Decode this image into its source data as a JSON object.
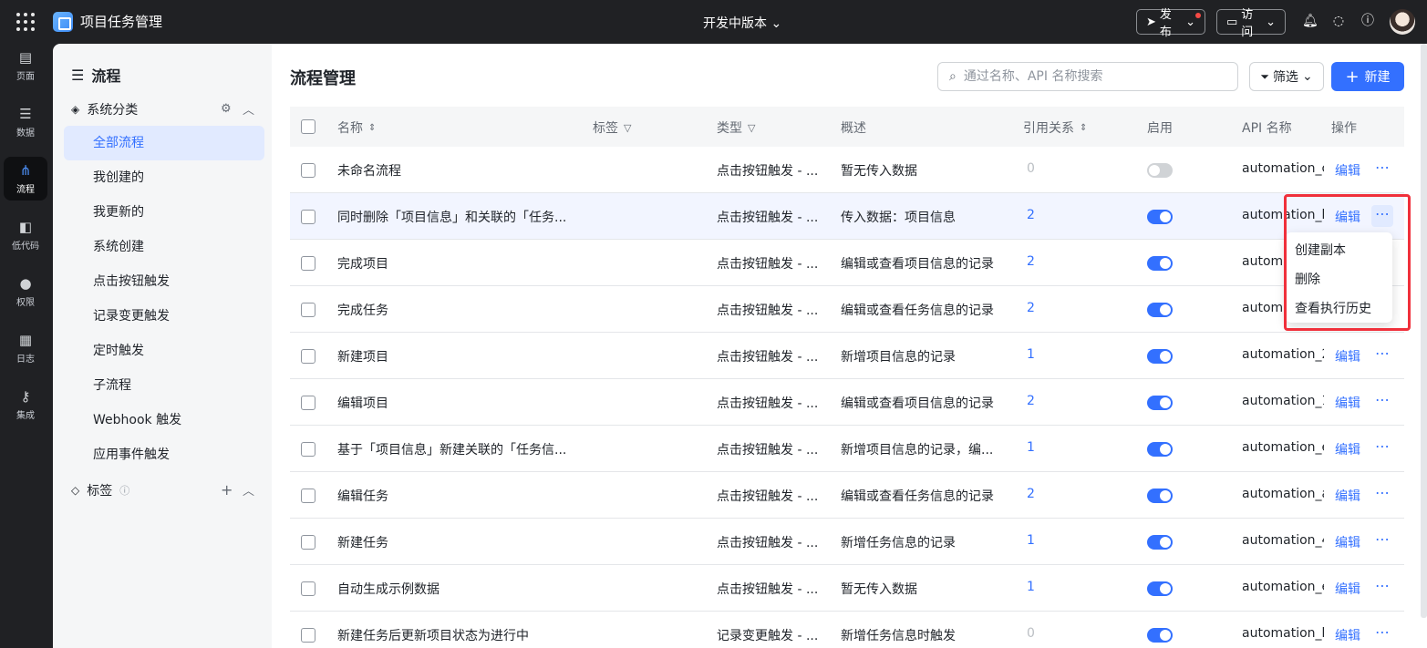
{
  "topbar": {
    "app_title": "项目任务管理",
    "version_label": "开发中版本",
    "publish_label": "发布",
    "visit_label": "访问"
  },
  "leftnav": {
    "items": [
      {
        "label": "页面",
        "icon": "page-icon"
      },
      {
        "label": "数据",
        "icon": "database-icon"
      },
      {
        "label": "流程",
        "icon": "flow-icon",
        "active": true
      },
      {
        "label": "低代码",
        "icon": "code-icon"
      },
      {
        "label": "权限",
        "icon": "users-icon"
      },
      {
        "label": "日志",
        "icon": "log-icon"
      },
      {
        "label": "集成",
        "icon": "key-icon"
      }
    ]
  },
  "sidebar": {
    "title": "流程",
    "category_section": "系统分类",
    "items": [
      "全部流程",
      "我创建的",
      "我更新的",
      "系统创建",
      "点击按钮触发",
      "记录变更触发",
      "定时触发",
      "子流程",
      "Webhook 触发",
      "应用事件触发"
    ],
    "tag_section": "标签"
  },
  "main": {
    "title": "流程管理",
    "search_placeholder": "通过名称、API 名称搜索",
    "filter_label": "筛选",
    "new_label": "新建"
  },
  "table": {
    "columns": {
      "name": "名称",
      "tag": "标签",
      "type": "类型",
      "desc": "概述",
      "ref": "引用关系",
      "enabled": "启用",
      "api": "API 名称",
      "ops": "操作"
    },
    "edit_label": "编辑",
    "rows": [
      {
        "name": "未命名流程",
        "type": "点击按钮触发 - ...",
        "desc": "暂无传入数据",
        "ref": "0",
        "enabled": false,
        "api": "automation_c"
      },
      {
        "name": "同时删除「项目信息」和关联的「任务...",
        "type": "点击按钮触发 - ...",
        "desc": "传入数据：项目信息",
        "ref": "2",
        "enabled": true,
        "api": "automation_b"
      },
      {
        "name": "完成项目",
        "type": "点击按钮触发 - ...",
        "desc": "编辑或查看项目信息的记录",
        "ref": "2",
        "enabled": true,
        "api": "automa"
      },
      {
        "name": "完成任务",
        "type": "点击按钮触发 - ...",
        "desc": "编辑或查看任务信息的记录",
        "ref": "2",
        "enabled": true,
        "api": "automa"
      },
      {
        "name": "新建项目",
        "type": "点击按钮触发 - ...",
        "desc": "新增项目信息的记录",
        "ref": "1",
        "enabled": true,
        "api": "automation_2"
      },
      {
        "name": "编辑项目",
        "type": "点击按钮触发 - ...",
        "desc": "编辑或查看项目信息的记录",
        "ref": "2",
        "enabled": true,
        "api": "automation_1"
      },
      {
        "name": "基于「项目信息」新建关联的「任务信...",
        "type": "点击按钮触发 - ...",
        "desc": "新增项目信息的记录，编...",
        "ref": "1",
        "enabled": true,
        "api": "automation_e"
      },
      {
        "name": "编辑任务",
        "type": "点击按钮触发 - ...",
        "desc": "编辑或查看任务信息的记录",
        "ref": "2",
        "enabled": true,
        "api": "automation_a"
      },
      {
        "name": "新建任务",
        "type": "点击按钮触发 - ...",
        "desc": "新增任务信息的记录",
        "ref": "1",
        "enabled": true,
        "api": "automation_4"
      },
      {
        "name": "自动生成示例数据",
        "type": "点击按钮触发 - ...",
        "desc": "暂无传入数据",
        "ref": "1",
        "enabled": true,
        "api": "automation_e"
      },
      {
        "name": "新建任务后更新项目状态为进行中",
        "type": "记录变更触发 - ...",
        "desc": "新增任务信息时触发",
        "ref": "0",
        "enabled": true,
        "api": "automation_b"
      }
    ]
  },
  "context_menu": {
    "items": [
      "创建副本",
      "删除",
      "查看执行历史"
    ]
  },
  "colors": {
    "accent": "#3370ff",
    "highlight_border": "#f0303b",
    "topbar_bg": "#202124"
  }
}
